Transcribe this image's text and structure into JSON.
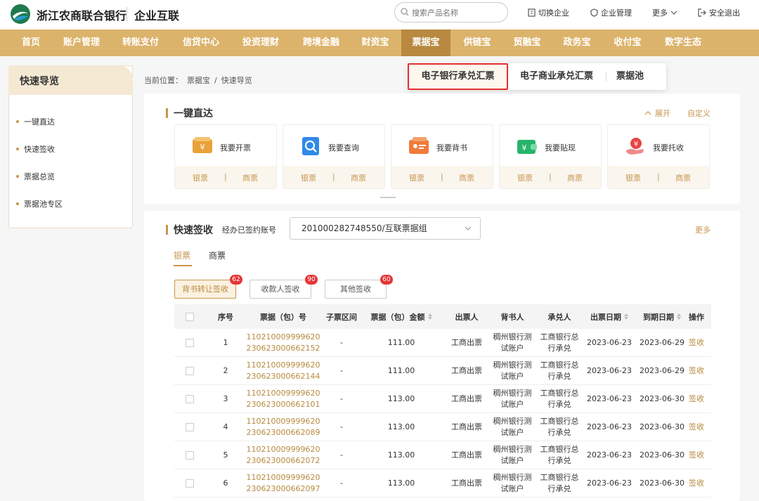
{
  "header": {
    "bank_name": "浙江农商联合银行",
    "product": "企业互联",
    "search_placeholder": "搜索产品名称",
    "switch_company": "切换企业",
    "company_manage": "企业管理",
    "more": "更多",
    "logout": "安全退出"
  },
  "nav": {
    "items": [
      "首页",
      "账户管理",
      "转账支付",
      "信贷中心",
      "投资理财",
      "跨境金融",
      "财资宝",
      "票据宝",
      "供链宝",
      "贸融宝",
      "政务宝",
      "收付宝",
      "数字生态"
    ],
    "active": "票据宝"
  },
  "dropdown": {
    "items": [
      "电子银行承兑汇票",
      "电子商业承兑汇票",
      "票据池"
    ]
  },
  "sidebar": {
    "title": "快速导览",
    "items": [
      "一键直达",
      "快速签收",
      "票据总览",
      "票据池专区"
    ]
  },
  "breadcrumb": {
    "prefix": "当前位置：",
    "level1": "票据宝",
    "sep": "/",
    "level2": "快速导览"
  },
  "quick_access": {
    "title": "一键直达",
    "expand": "展开",
    "customize": "自定义",
    "cards": [
      {
        "label": "我要开票",
        "icon": "yuan-ticket-icon",
        "bank": "银票",
        "commercial": "商票"
      },
      {
        "label": "我要查询",
        "icon": "search-doc-icon",
        "bank": "银票",
        "commercial": "商票"
      },
      {
        "label": "我要背书",
        "icon": "endorse-card-icon",
        "bank": "银票",
        "commercial": "商票"
      },
      {
        "label": "我要贴现",
        "icon": "discount-wallet-icon",
        "bank": "银票",
        "commercial": "商票"
      },
      {
        "label": "我要托收",
        "icon": "collect-hand-icon",
        "bank": "银票",
        "commercial": "商票"
      }
    ]
  },
  "quick_sign": {
    "title": "快速签收",
    "account_label": "经办已签约账号",
    "account_value": "201000282748550/互联票据组",
    "more": "更多",
    "tabs": [
      "银票",
      "商票"
    ],
    "active_tab": "银票",
    "filters": [
      {
        "label": "背书转让签收",
        "count": "62"
      },
      {
        "label": "收款人签收",
        "count": "90"
      },
      {
        "label": "其他签收",
        "count": "60"
      }
    ]
  },
  "table": {
    "columns": [
      "序号",
      "票据（包）号",
      "子票区间",
      "票据（包）金额",
      "出票人",
      "背书人",
      "承兑人",
      "出票日期",
      "到期日期",
      "操作"
    ],
    "rows": [
      {
        "no": "1",
        "bill1": "110210009999620",
        "bill2": "230623000662152",
        "range": "-",
        "amount": "111.00",
        "drawer": "工商出票",
        "endorser1": "稠州银行测",
        "endorser2": "试账户",
        "acceptor1": "工商银行总",
        "acceptor2": "行承兑",
        "issue": "2023-06-23",
        "due": "2023-06-29",
        "action": "签收"
      },
      {
        "no": "2",
        "bill1": "110210009999620",
        "bill2": "230623000662144",
        "range": "-",
        "amount": "111.00",
        "drawer": "工商出票",
        "endorser1": "稠州银行测",
        "endorser2": "试账户",
        "acceptor1": "工商银行总",
        "acceptor2": "行承兑",
        "issue": "2023-06-23",
        "due": "2023-06-29",
        "action": "签收"
      },
      {
        "no": "3",
        "bill1": "110210009999620",
        "bill2": "230623000662101",
        "range": "-",
        "amount": "113.00",
        "drawer": "工商出票",
        "endorser1": "稠州银行测",
        "endorser2": "试账户",
        "acceptor1": "工商银行总",
        "acceptor2": "行承兑",
        "issue": "2023-06-23",
        "due": "2023-06-30",
        "action": "签收"
      },
      {
        "no": "4",
        "bill1": "110210009999620",
        "bill2": "230623000662089",
        "range": "-",
        "amount": "113.00",
        "drawer": "工商出票",
        "endorser1": "稠州银行测",
        "endorser2": "试账户",
        "acceptor1": "工商银行总",
        "acceptor2": "行承兑",
        "issue": "2023-06-23",
        "due": "2023-06-30",
        "action": "签收"
      },
      {
        "no": "5",
        "bill1": "110210009999620",
        "bill2": "230623000662072",
        "range": "-",
        "amount": "113.00",
        "drawer": "工商出票",
        "endorser1": "稠州银行测",
        "endorser2": "试账户",
        "acceptor1": "工商银行总",
        "acceptor2": "行承兑",
        "issue": "2023-06-23",
        "due": "2023-06-30",
        "action": "签收"
      },
      {
        "no": "6",
        "bill1": "110210009999620",
        "bill2": "230623000662097",
        "range": "-",
        "amount": "113.00",
        "drawer": "工商出票",
        "endorser1": "稠州银行测",
        "endorser2": "试账户",
        "acceptor1": "工商银行总",
        "acceptor2": "行承兑",
        "issue": "2023-06-23",
        "due": "2023-06-30",
        "action": "签收"
      }
    ]
  },
  "colors": {
    "accent": "#c7954d",
    "nav_bg": "#dcb36b",
    "nav_active": "#b8893f",
    "badge": "#e53535",
    "highlight_border": "#e53030"
  }
}
